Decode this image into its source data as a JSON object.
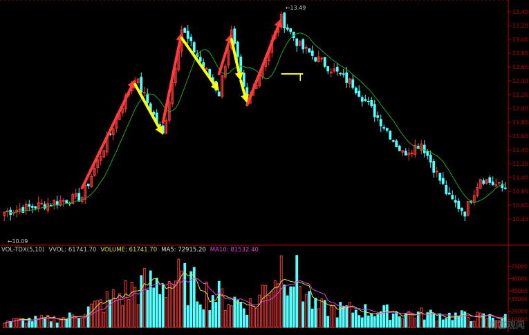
{
  "colors": {
    "background": "#000000",
    "axis": "#c00000",
    "up": "#ff3b3b",
    "down": "#54ffff",
    "ma": "#1fa81f",
    "vol_ma5": "#e0e040",
    "vol_ma10": "#e040e0",
    "label": "#c8c8c8",
    "arrow_up": "#ff3c3c",
    "arrow_down": "#ffff00"
  },
  "volume_header": {
    "indicator": "VOL-TDX(5,10)",
    "vvol": "VVOL: 61741.70",
    "volume": "VOLUME: 61741.70",
    "ma5": "MA5: 72915.20",
    "ma10": "MA10: 81532.40"
  },
  "watermark": "财富观闻",
  "chart_data": [
    {
      "type": "candlestick",
      "title": "",
      "ylim": [
        10.09,
        13.49
      ],
      "y_ticks": [
        "13.40",
        "13.20",
        "13.00",
        "12.80",
        "12.60",
        "12.40",
        "12.20",
        "12.00",
        "11.80",
        "11.60",
        "11.40",
        "11.20",
        "11.00",
        "10.80",
        "10.60",
        "10.40"
      ],
      "annotations": {
        "high": "13.49",
        "low": "10.09"
      },
      "ma_series": "MA",
      "swing_points": [
        {
          "index": 0,
          "value": 10.5
        },
        {
          "index": 25,
          "value": 10.72
        },
        {
          "index": 42,
          "value": 12.46
        },
        {
          "index": 51,
          "value": 11.62
        },
        {
          "index": 57,
          "value": 13.15
        },
        {
          "index": 69,
          "value": 12.22
        },
        {
          "index": 73,
          "value": 13.1
        },
        {
          "index": 78,
          "value": 12.06
        },
        {
          "index": 89,
          "value": 13.3
        },
        {
          "index": 95,
          "value": 12.9
        },
        {
          "index": 112,
          "value": 12.35
        },
        {
          "index": 122,
          "value": 11.75
        },
        {
          "index": 128,
          "value": 11.35
        },
        {
          "index": 134,
          "value": 11.5
        },
        {
          "index": 143,
          "value": 10.7
        },
        {
          "index": 148,
          "value": 10.5
        },
        {
          "index": 153,
          "value": 11.0
        },
        {
          "index": 160,
          "value": 10.85
        }
      ],
      "arrows_up": [
        [
          25,
          10.85,
          42,
          12.42
        ],
        [
          51,
          11.8,
          57,
          13.1
        ],
        [
          69,
          12.5,
          73,
          13.08
        ],
        [
          78,
          12.05,
          89,
          13.3
        ]
      ],
      "arrows_down": [
        [
          42,
          12.35,
          51,
          11.62
        ],
        [
          57,
          13.02,
          69,
          12.25
        ],
        [
          73,
          13.0,
          76,
          12.4
        ],
        [
          76,
          12.4,
          78,
          12.08
        ]
      ],
      "support_line": {
        "from_index": 89,
        "to_index": 96,
        "value": 12.5
      }
    },
    {
      "type": "bar",
      "title": "",
      "ylim": [
        0,
        90000
      ],
      "y_ticks": [
        "75000",
        "60000",
        "45000",
        "35000",
        "20000",
        "10000"
      ],
      "series": [
        {
          "name": "VOLUME",
          "color_by": "candle"
        },
        {
          "name": "MA5"
        },
        {
          "name": "MA10"
        }
      ],
      "volume_swing_points": [
        {
          "index": 0,
          "value": 8000
        },
        {
          "index": 20,
          "value": 12000
        },
        {
          "index": 30,
          "value": 28000
        },
        {
          "index": 42,
          "value": 50000
        },
        {
          "index": 55,
          "value": 62000
        },
        {
          "index": 65,
          "value": 45000
        },
        {
          "index": 80,
          "value": 28000
        },
        {
          "index": 90,
          "value": 88000
        },
        {
          "index": 100,
          "value": 25000
        },
        {
          "index": 130,
          "value": 18000
        },
        {
          "index": 160,
          "value": 12000
        }
      ]
    }
  ]
}
